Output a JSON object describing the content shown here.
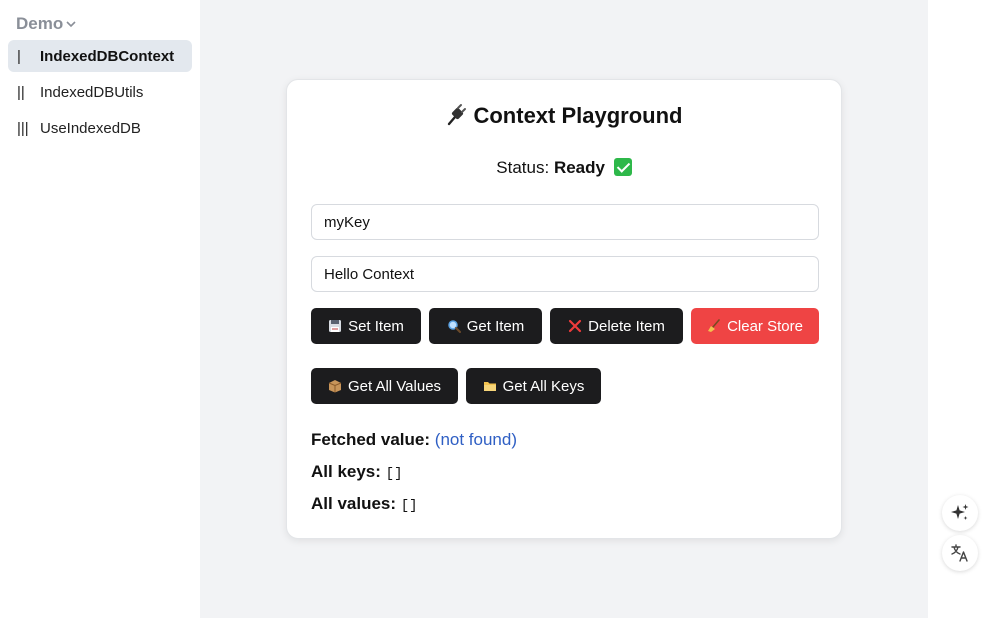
{
  "sidebar": {
    "title": "Demo",
    "items": [
      {
        "num": "|",
        "label": "IndexedDBContext",
        "active": true
      },
      {
        "num": "||",
        "label": "IndexedDBUtils",
        "active": false
      },
      {
        "num": "|||",
        "label": "UseIndexedDB",
        "active": false
      }
    ]
  },
  "card": {
    "title": "Context Playground",
    "status_label": "Status:",
    "status_value": "Ready",
    "key_input": {
      "value": "myKey"
    },
    "value_input": {
      "value": "Hello Context"
    },
    "buttons": {
      "set": "Set Item",
      "get": "Get Item",
      "delete": "Delete Item",
      "clear": "Clear Store",
      "get_all_values": "Get All Values",
      "get_all_keys": "Get All Keys"
    },
    "results": {
      "fetched_label": "Fetched value:",
      "fetched_value": "(not found)",
      "keys_label": "All keys:",
      "keys_value": "[]",
      "values_label": "All values:",
      "values_value": "[]"
    }
  },
  "colors": {
    "accent_dark": "#1c1c1e",
    "danger": "#ef4444",
    "link": "#2f5fc4",
    "status_ok": "#2eb84a"
  }
}
